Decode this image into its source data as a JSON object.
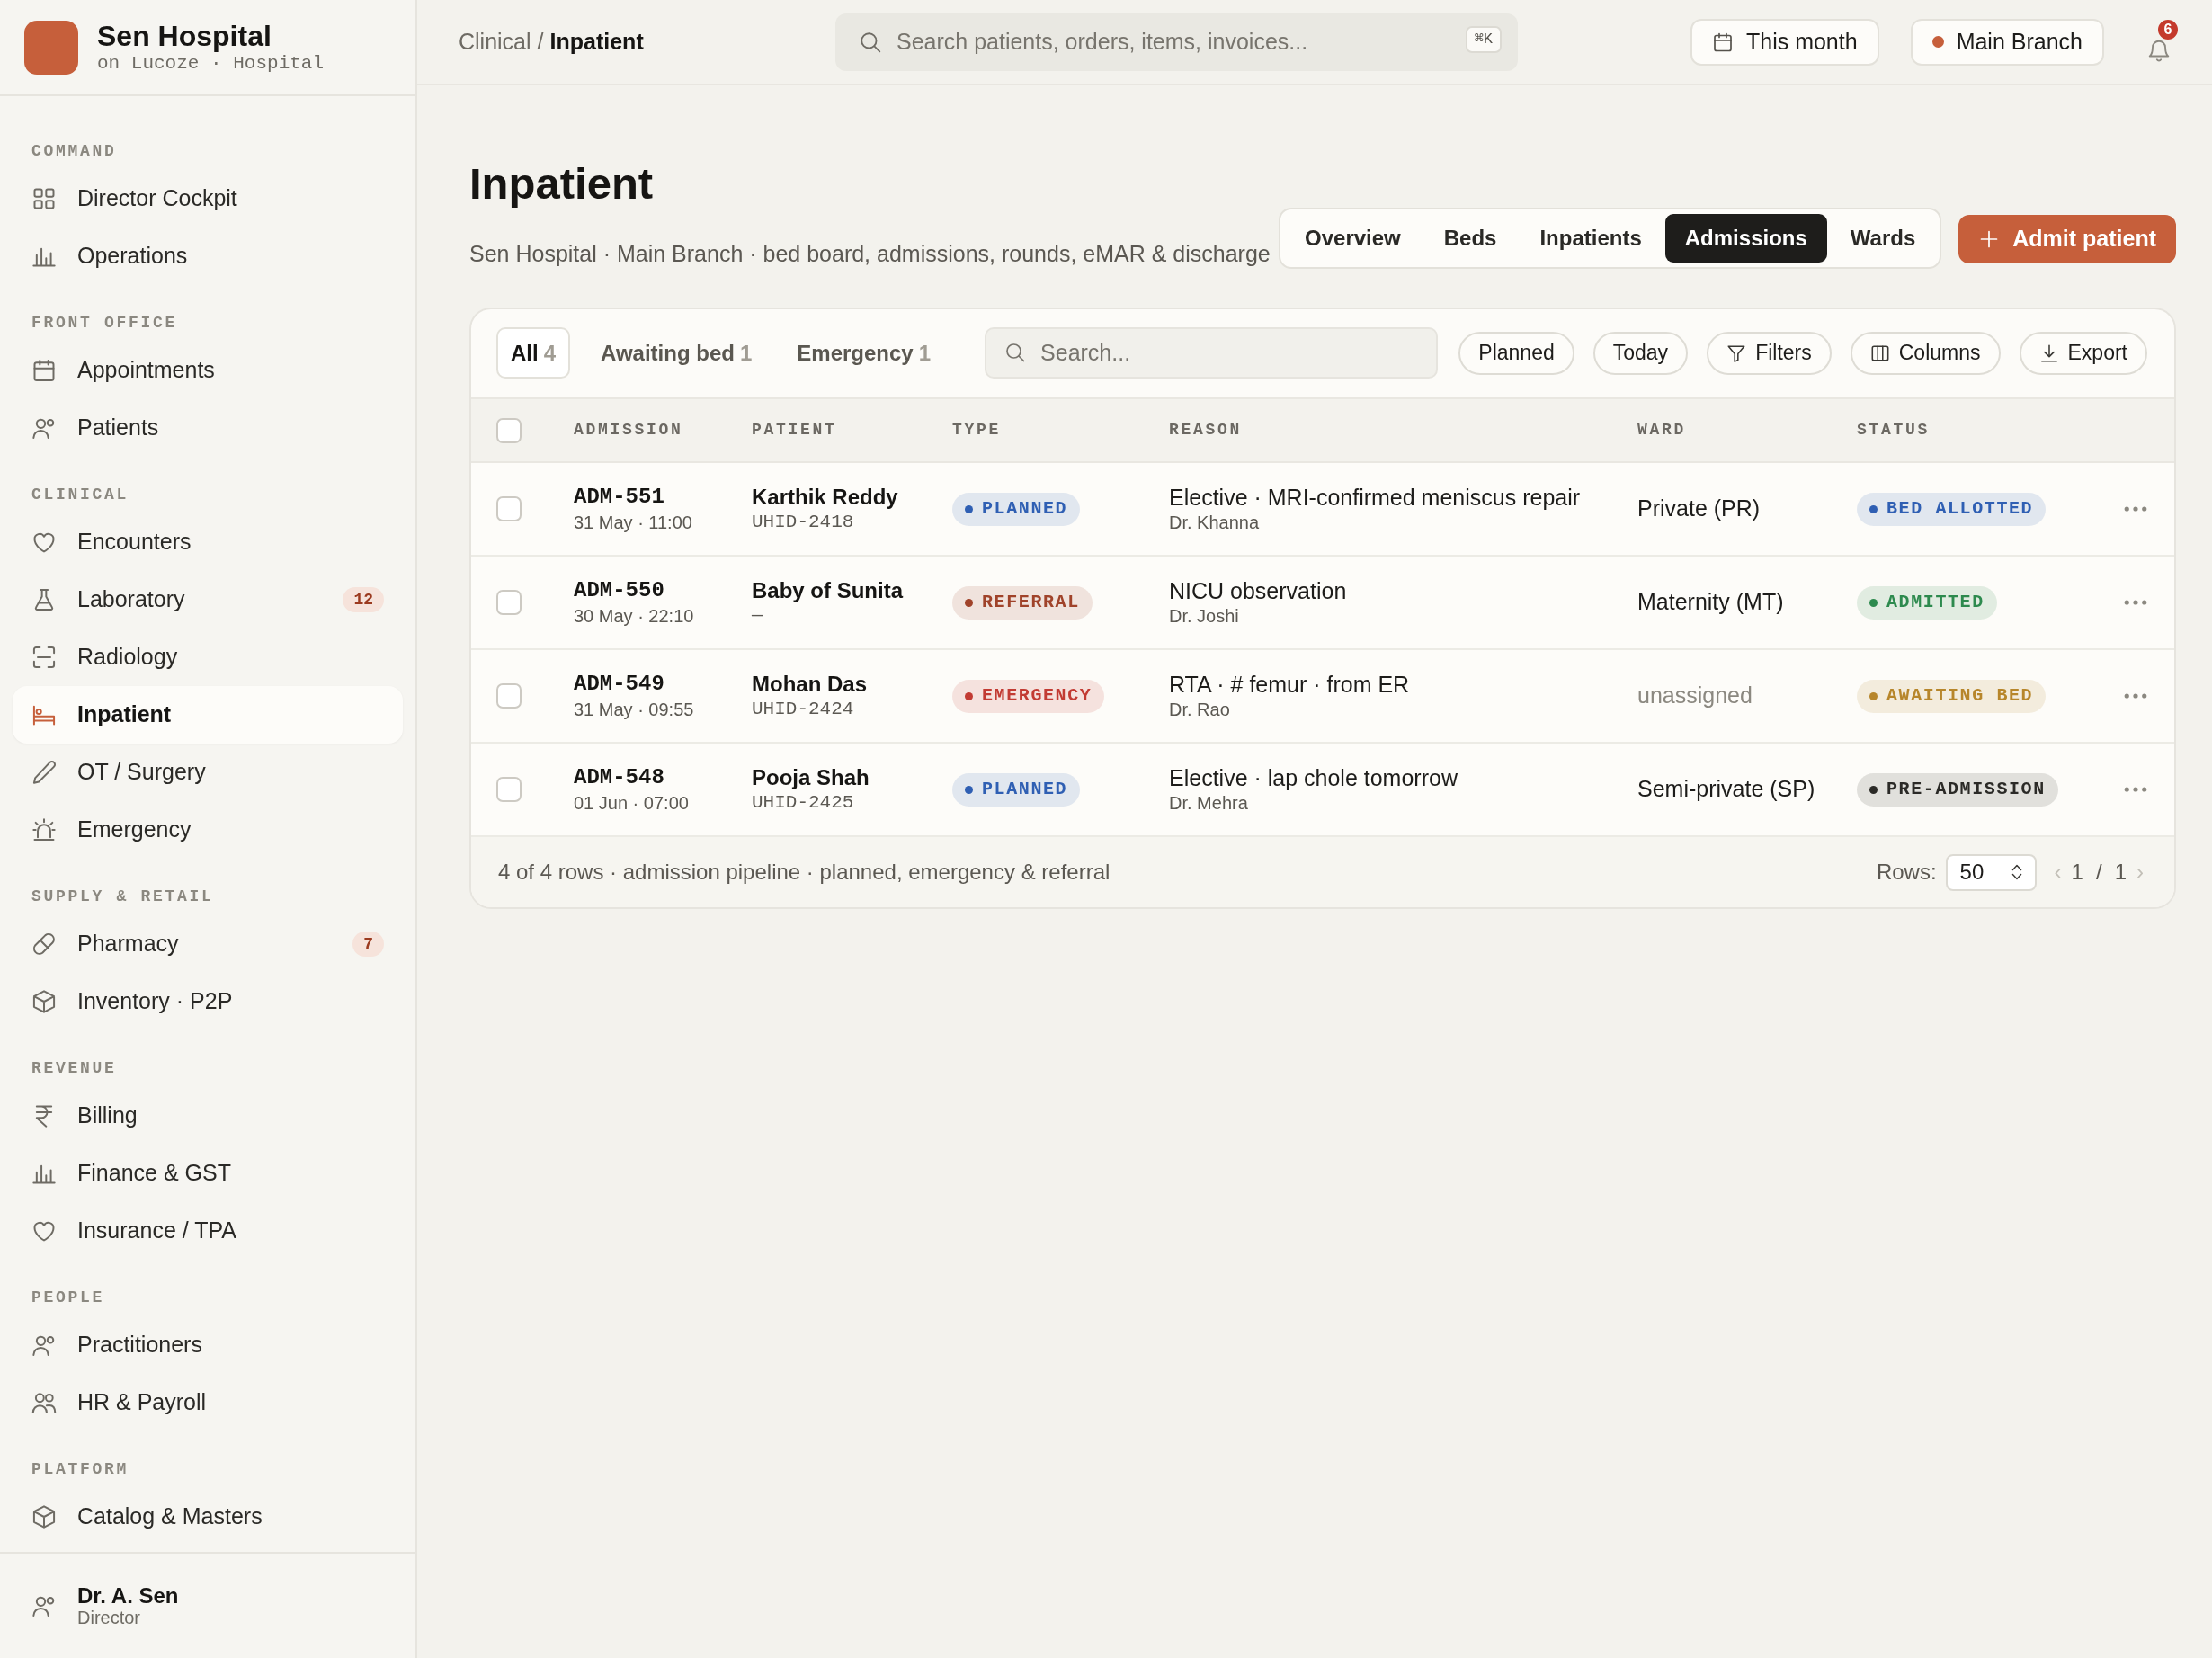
{
  "sidebar": {
    "brand": {
      "name": "Sen Hospital",
      "subtitle": "on Lucoze · Hospital"
    },
    "sections": [
      {
        "label": "COMMAND",
        "items": [
          {
            "label": "Director Cockpit",
            "selected": false
          },
          {
            "label": "Operations",
            "selected": false
          }
        ]
      },
      {
        "label": "FRONT OFFICE",
        "items": [
          {
            "label": "Appointments",
            "selected": false
          },
          {
            "label": "Patients",
            "selected": false
          }
        ]
      },
      {
        "label": "CLINICAL",
        "items": [
          {
            "label": "Encounters",
            "selected": false
          },
          {
            "label": "Laboratory",
            "selected": false,
            "badge": "12"
          },
          {
            "label": "Radiology",
            "selected": false
          },
          {
            "label": "Inpatient",
            "selected": true
          },
          {
            "label": "OT / Surgery",
            "selected": false
          },
          {
            "label": "Emergency",
            "selected": false
          }
        ]
      },
      {
        "label": "SUPPLY & RETAIL",
        "items": [
          {
            "label": "Pharmacy",
            "selected": false,
            "badge": "7"
          },
          {
            "label": "Inventory · P2P",
            "selected": false
          }
        ]
      },
      {
        "label": "REVENUE",
        "items": [
          {
            "label": "Billing",
            "selected": false
          },
          {
            "label": "Finance & GST",
            "selected": false
          },
          {
            "label": "Insurance / TPA",
            "selected": false
          }
        ]
      },
      {
        "label": "PEOPLE",
        "items": [
          {
            "label": "Practitioners",
            "selected": false
          },
          {
            "label": "HR & Payroll",
            "selected": false
          }
        ]
      },
      {
        "label": "PLATFORM",
        "items": [
          {
            "label": "Catalog & Masters",
            "selected": false
          }
        ]
      }
    ],
    "user": {
      "name": "Dr. A. Sen",
      "role": "Director"
    }
  },
  "topbar": {
    "breadcrumb": {
      "parent": "Clinical",
      "separator": "/",
      "current": "Inpatient"
    },
    "search": {
      "placeholder": "Search patients, orders, items, invoices...",
      "shortcut": "⌘K"
    },
    "period": "This month",
    "branch": "Main Branch",
    "notifications": "6"
  },
  "page": {
    "title": "Inpatient",
    "subtitle": "Sen Hospital · Main Branch · bed board, admissions, rounds, eMAR & discharge",
    "tabs": [
      {
        "label": "Overview",
        "selected": false
      },
      {
        "label": "Beds",
        "selected": false
      },
      {
        "label": "Inpatients",
        "selected": false
      },
      {
        "label": "Admissions",
        "selected": true
      },
      {
        "label": "Wards",
        "selected": false
      }
    ],
    "primary_action": "Admit patient"
  },
  "admissions": {
    "segments": [
      {
        "label": "All",
        "count": "4",
        "selected": true
      },
      {
        "label": "Awaiting bed",
        "count": "1",
        "selected": false
      },
      {
        "label": "Emergency",
        "count": "1",
        "selected": false
      }
    ],
    "search": {
      "placeholder": "Search..."
    },
    "chips": [
      "Planned",
      "Today",
      "Filters",
      "Columns",
      "Export"
    ],
    "table": {
      "select_all": {
        "checked": false
      },
      "columns": [
        "ADMISSION",
        "PATIENT",
        "TYPE",
        "REASON",
        "WARD",
        "STATUS"
      ],
      "rows": [
        {
          "checked": false,
          "admission": "ADM-551",
          "admitted_at": "31 May · 11:00",
          "patient": "Karthik Reddy",
          "uhid": "UHID-2418",
          "type": {
            "label": "PLANNED",
            "color": "#2f5fb3"
          },
          "reason": "Elective · MRI-confirmed meniscus repair",
          "doctor": "Dr. Khanna",
          "ward": "Private (PR)",
          "ward_assigned": true,
          "status": {
            "label": "BED ALLOTTED",
            "color": "#2f5fb3"
          }
        },
        {
          "checked": false,
          "admission": "ADM-550",
          "admitted_at": "30 May · 22:10",
          "patient": "Baby of Sunita",
          "uhid": "—",
          "type": {
            "label": "REFERRAL",
            "color": "#a0432a"
          },
          "reason": "NICU observation",
          "doctor": "Dr. Joshi",
          "ward": "Maternity (MT)",
          "ward_assigned": true,
          "status": {
            "label": "ADMITTED",
            "color": "#2d8a4e"
          }
        },
        {
          "checked": false,
          "admission": "ADM-549",
          "admitted_at": "31 May · 09:55",
          "patient": "Mohan Das",
          "uhid": "UHID-2424",
          "type": {
            "label": "EMERGENCY",
            "color": "#c23b33"
          },
          "reason": "RTA · # femur · from ER",
          "doctor": "Dr. Rao",
          "ward": "unassigned",
          "ward_assigned": false,
          "status": {
            "label": "AWAITING BED",
            "color": "#b7862b"
          }
        },
        {
          "checked": false,
          "admission": "ADM-548",
          "admitted_at": "01 Jun · 07:00",
          "patient": "Pooja Shah",
          "uhid": "UHID-2425",
          "type": {
            "label": "PLANNED",
            "color": "#2f5fb3"
          },
          "reason": "Elective · lap chole tomorrow",
          "doctor": "Dr. Mehra",
          "ward": "Semi-private (SP)",
          "ward_assigned": true,
          "status": {
            "label": "PRE-ADMISSION",
            "color": "#2b2a27"
          }
        }
      ]
    },
    "footer": {
      "summary": "4 of 4 rows · admission pipeline · planned, emergency & referral",
      "rows_label": "Rows:",
      "rows_per_page": "50",
      "pager": {
        "previous": {
          "label": "‹",
          "disabled": true
        },
        "page": "1",
        "separator": "/",
        "total": "1",
        "next": {
          "label": "›",
          "disabled": true
        }
      }
    }
  }
}
